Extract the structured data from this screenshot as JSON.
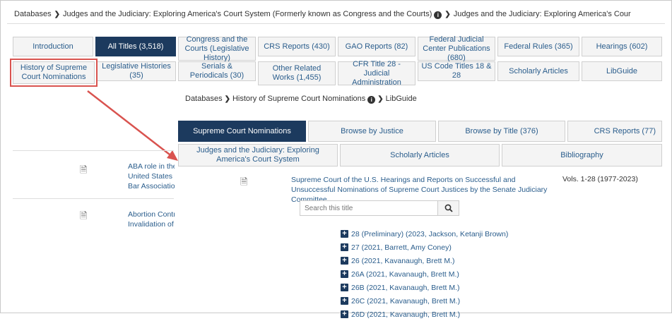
{
  "breadcrumb": {
    "item1": "Databases",
    "item2": "Judges and the Judiciary: Exploring America's Court System (Formerly known as Congress and the Courts)",
    "item3": "Judges and the Judiciary: Exploring America's Cour"
  },
  "main_tabs": [
    {
      "label": "Introduction"
    },
    {
      "label": "All Titles (3,518)"
    },
    {
      "label": "Congress and the Courts (Legislative History)"
    },
    {
      "label": "CRS Reports (430)"
    },
    {
      "label": "GAO Reports (82)"
    },
    {
      "label": "Federal Judicial Center Publications (680)"
    },
    {
      "label": "Federal Rules (365)"
    },
    {
      "label": "Hearings (602)"
    },
    {
      "label": "History of Supreme Court Nominations"
    },
    {
      "label": "Legislative Histories (35)"
    },
    {
      "label": "Serials & Periodicals (30)"
    },
    {
      "label": "Other Related Works (1,455)"
    },
    {
      "label": "CFR Title 28 - Judicial Administration"
    },
    {
      "label": "US Code Titles 18 & 28"
    },
    {
      "label": "Scholarly Articles"
    },
    {
      "label": "LibGuide"
    }
  ],
  "sub_breadcrumb": {
    "item1": "Databases",
    "item2": "History of Supreme Court Nominations",
    "item3": "LibGuide"
  },
  "sub_tabs": [
    {
      "label": "Supreme Court Nominations"
    },
    {
      "label": "Browse by Justice"
    },
    {
      "label": "Browse by Title (376)"
    },
    {
      "label": "CRS Reports (77)"
    },
    {
      "label": "Judges and the Judiciary: Exploring America's Court System"
    },
    {
      "label": "Scholarly Articles"
    },
    {
      "label": "Bibliography"
    }
  ],
  "background_rows": [
    {
      "lines": [
        "ABA role in the j",
        "United States Se",
        "Bar Association"
      ]
    },
    {
      "lines": [
        "Abortion Contro",
        "Invalidation of F"
      ]
    }
  ],
  "item": {
    "title": "Supreme Court of the U.S. Hearings and Reports on Successful and Unsuccessful Nominations of Supreme Court Justices by the Senate Judiciary Committee",
    "volumes": "Vols. 1-28 (1977-2023)"
  },
  "search": {
    "placeholder": "Search this title"
  },
  "volumes": [
    "28 (Preliminary)  (2023, Jackson, Ketanji Brown)",
    "27  (2021, Barrett, Amy Coney)",
    "26  (2021, Kavanaugh, Brett M.)",
    "26A  (2021, Kavanaugh, Brett M.)",
    "26B  (2021, Kavanaugh, Brett M.)",
    "26C  (2021, Kavanaugh, Brett M.)",
    "26D  (2021, Kavanaugh, Brett M.)"
  ],
  "colors": {
    "active_tab": "#1c3a5e",
    "link": "#2a5d8c",
    "highlight": "#d9534f"
  }
}
